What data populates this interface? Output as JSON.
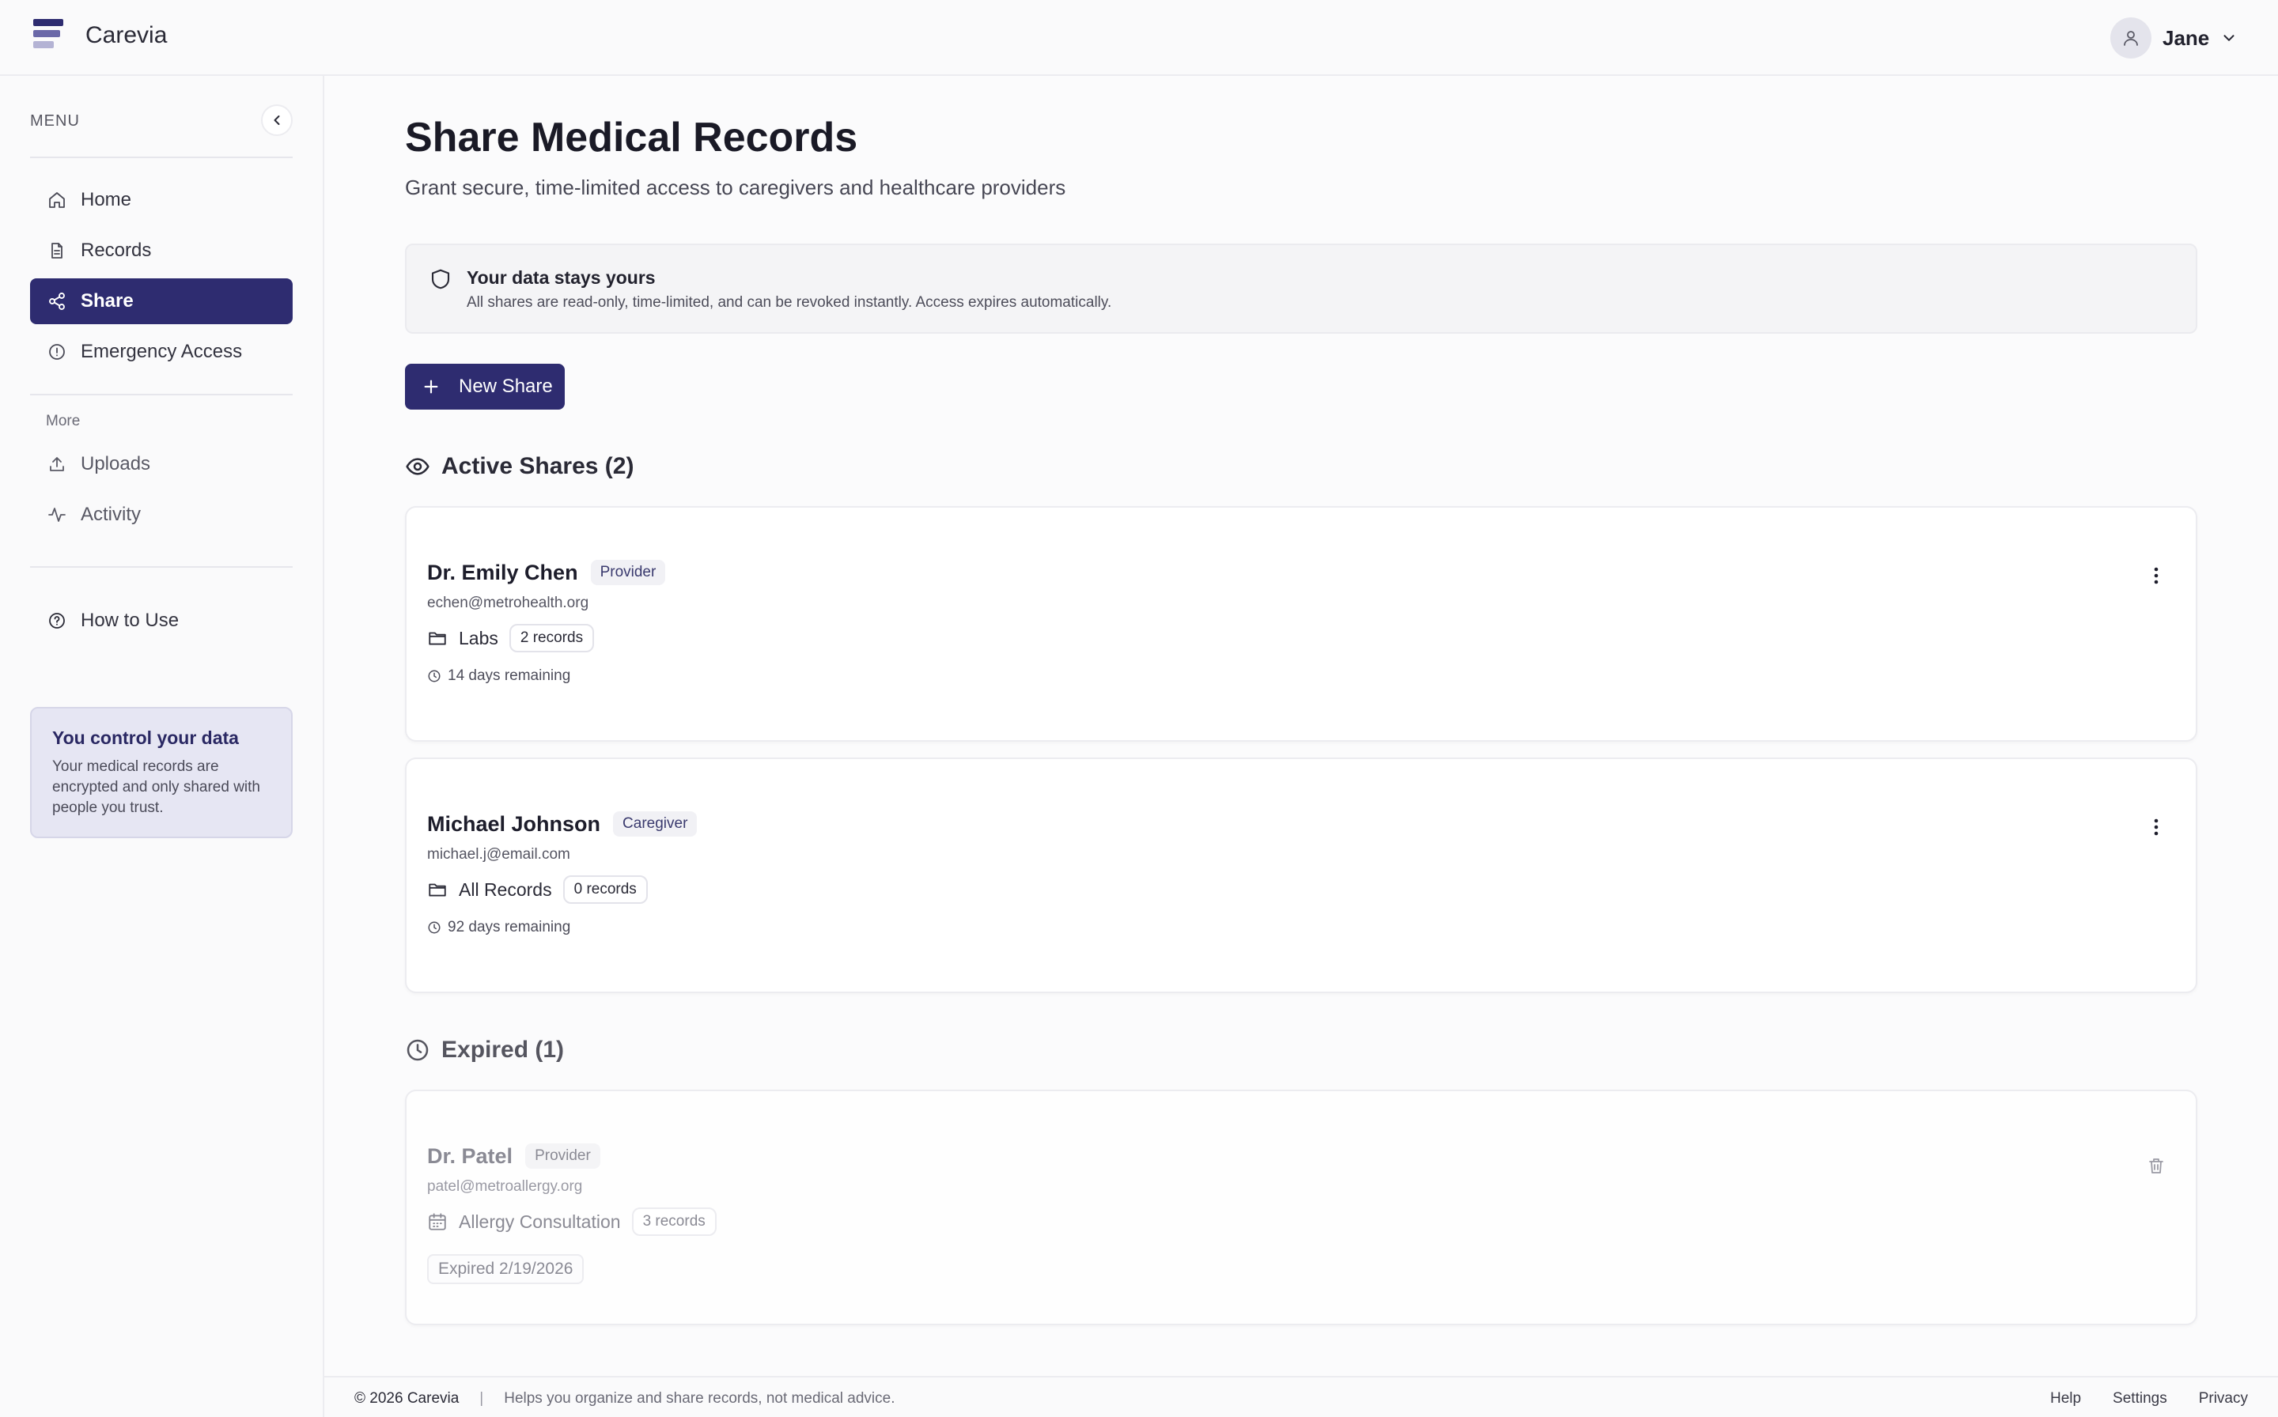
{
  "app": {
    "name": "Carevia"
  },
  "user": {
    "name": "Jane"
  },
  "sidebar": {
    "menu_label": "MENU",
    "primary": [
      {
        "label": "Home",
        "icon": "home-icon"
      },
      {
        "label": "Records",
        "icon": "document-icon"
      },
      {
        "label": "Share",
        "icon": "share-icon",
        "active": true
      },
      {
        "label": "Emergency Access",
        "icon": "alert-circle-icon"
      }
    ],
    "more_label": "More",
    "secondary": [
      {
        "label": "Uploads",
        "icon": "upload-icon"
      },
      {
        "label": "Activity",
        "icon": "activity-icon"
      }
    ],
    "help": {
      "label": "How to Use",
      "icon": "help-circle-icon"
    },
    "info_card": {
      "title": "You control your data",
      "body": "Your medical records are encrypted and only shared with people you trust."
    }
  },
  "page": {
    "title": "Share Medical Records",
    "subtitle": "Grant secure, time-limited access to caregivers and healthcare providers"
  },
  "notice": {
    "title": "Your data stays yours",
    "body": "All shares are read-only, time-limited, and can be revoked instantly. Access expires automatically."
  },
  "new_share_label": "New Share",
  "active_section": {
    "title": "Active Shares (2)",
    "shares": [
      {
        "name": "Dr. Emily Chen",
        "role": "Provider",
        "email": "echen@metrohealth.org",
        "scope": "Labs",
        "count": "2 records",
        "remaining": "14 days remaining"
      },
      {
        "name": "Michael Johnson",
        "role": "Caregiver",
        "email": "michael.j@email.com",
        "scope": "All Records",
        "count": "0 records",
        "remaining": "92 days remaining"
      }
    ]
  },
  "expired_section": {
    "title": "Expired (1)",
    "shares": [
      {
        "name": "Dr. Patel",
        "role": "Provider",
        "email": "patel@metroallergy.org",
        "scope": "Allergy Consultation",
        "count": "3 records",
        "status": "Expired 2/19/2026"
      }
    ]
  },
  "footer": {
    "copyright": "© 2026 Carevia",
    "separator": "|",
    "tagline": "Helps you organize and share records, not medical advice.",
    "links": [
      "Help",
      "Settings",
      "Privacy"
    ]
  },
  "colors": {
    "accent": "#2e2c70",
    "info_card_bg": "#e6e6f3",
    "badge_bg": "#f1f1f5"
  }
}
